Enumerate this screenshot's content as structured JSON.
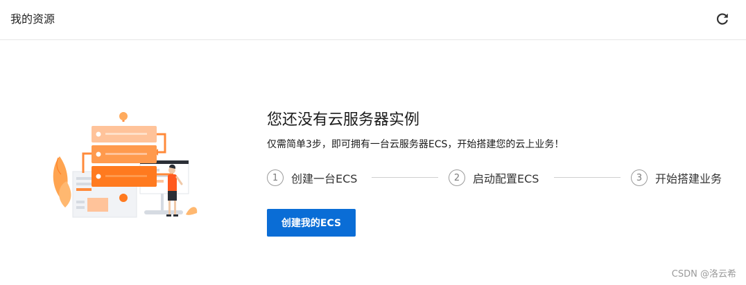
{
  "header": {
    "title": "我的资源",
    "refresh_icon": "refresh-icon"
  },
  "empty_state": {
    "title": "您还没有云服务器实例",
    "description": "仅需简单3步，即可拥有一台云服务器ECS，开始搭建您的云上业务！",
    "steps": [
      {
        "number": "1",
        "label": "创建一台ECS"
      },
      {
        "number": "2",
        "label": "启动配置ECS"
      },
      {
        "number": "3",
        "label": "开始搭建业务"
      }
    ],
    "button_label": "创建我的ECS"
  },
  "watermark": "CSDN @洛云希",
  "colors": {
    "primary": "#0a6dd6",
    "illustration_orange": "#ff7a1f",
    "illustration_light": "#ffc39a"
  }
}
